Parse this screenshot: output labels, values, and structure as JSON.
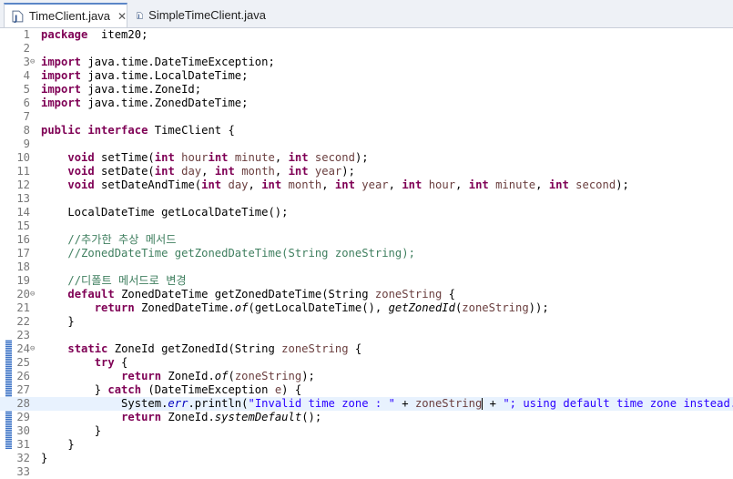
{
  "tabs": [
    {
      "label": "TimeClient.java",
      "active": true,
      "close_icon": "close-icon"
    },
    {
      "label": "SimpleTimeClient.java",
      "active": false
    }
  ],
  "editor": {
    "lines": [
      {
        "n": "1",
        "fold": "",
        "tokens": [
          [
            "kw",
            "package"
          ],
          [
            "",
            "  item20;"
          ]
        ]
      },
      {
        "n": "2",
        "fold": "",
        "tokens": []
      },
      {
        "n": "3",
        "fold": "⊖",
        "tokens": [
          [
            "kw",
            "import"
          ],
          [
            "",
            " java.time.DateTimeException;"
          ]
        ]
      },
      {
        "n": "4",
        "fold": "",
        "tokens": [
          [
            "kw",
            "import"
          ],
          [
            "",
            " java.time.LocalDateTime;"
          ]
        ]
      },
      {
        "n": "5",
        "fold": "",
        "tokens": [
          [
            "kw",
            "import"
          ],
          [
            "",
            " java.time.ZoneId;"
          ]
        ]
      },
      {
        "n": "6",
        "fold": "",
        "tokens": [
          [
            "kw",
            "import"
          ],
          [
            "",
            " java.time.ZonedDateTime;"
          ]
        ]
      },
      {
        "n": "7",
        "fold": "",
        "tokens": []
      },
      {
        "n": "8",
        "fold": "",
        "tokens": [
          [
            "kw",
            "public"
          ],
          [
            "",
            " "
          ],
          [
            "kw",
            "interface"
          ],
          [
            "",
            " TimeClient {"
          ]
        ]
      },
      {
        "n": "9",
        "fold": "",
        "tokens": []
      },
      {
        "n": "10",
        "fold": "",
        "tokens": [
          [
            "",
            "    "
          ],
          [
            "kw",
            "void"
          ],
          [
            "",
            " setTime("
          ],
          [
            "kw",
            "int"
          ],
          [
            "",
            " "
          ],
          [
            "pa",
            "hour"
          ],
          [
            ", "
          ],
          [
            "kw",
            "int"
          ],
          [
            "",
            " "
          ],
          [
            "pa",
            "minute"
          ],
          [
            "",
            ", "
          ],
          [
            "kw",
            "int"
          ],
          [
            "",
            " "
          ],
          [
            "pa",
            "second"
          ],
          [
            "",
            ");"
          ]
        ]
      },
      {
        "n": "11",
        "fold": "",
        "tokens": [
          [
            "",
            "    "
          ],
          [
            "kw",
            "void"
          ],
          [
            "",
            " setDate("
          ],
          [
            "kw",
            "int"
          ],
          [
            "",
            " "
          ],
          [
            "pa",
            "day"
          ],
          [
            "",
            ", "
          ],
          [
            "kw",
            "int"
          ],
          [
            "",
            " "
          ],
          [
            "pa",
            "month"
          ],
          [
            "",
            ", "
          ],
          [
            "kw",
            "int"
          ],
          [
            "",
            " "
          ],
          [
            "pa",
            "year"
          ],
          [
            "",
            ");"
          ]
        ]
      },
      {
        "n": "12",
        "fold": "",
        "tokens": [
          [
            "",
            "    "
          ],
          [
            "kw",
            "void"
          ],
          [
            "",
            " setDateAndTime("
          ],
          [
            "kw",
            "int"
          ],
          [
            "",
            " "
          ],
          [
            "pa",
            "day"
          ],
          [
            "",
            ", "
          ],
          [
            "kw",
            "int"
          ],
          [
            "",
            " "
          ],
          [
            "pa",
            "month"
          ],
          [
            "",
            ", "
          ],
          [
            "kw",
            "int"
          ],
          [
            "",
            " "
          ],
          [
            "pa",
            "year"
          ],
          [
            "",
            ", "
          ],
          [
            "kw",
            "int"
          ],
          [
            "",
            " "
          ],
          [
            "pa",
            "hour"
          ],
          [
            "",
            ", "
          ],
          [
            "kw",
            "int"
          ],
          [
            "",
            " "
          ],
          [
            "pa",
            "minute"
          ],
          [
            "",
            ", "
          ],
          [
            "kw",
            "int"
          ],
          [
            "",
            " "
          ],
          [
            "pa",
            "second"
          ],
          [
            "",
            ");"
          ]
        ]
      },
      {
        "n": "13",
        "fold": "",
        "tokens": []
      },
      {
        "n": "14",
        "fold": "",
        "tokens": [
          [
            "",
            "    LocalDateTime getLocalDateTime();"
          ]
        ]
      },
      {
        "n": "15",
        "fold": "",
        "tokens": []
      },
      {
        "n": "16",
        "fold": "",
        "tokens": [
          [
            "",
            "    "
          ],
          [
            "cm",
            "//추가한 추상 메서드"
          ]
        ]
      },
      {
        "n": "17",
        "fold": "",
        "tokens": [
          [
            "",
            "    "
          ],
          [
            "cm",
            "//ZonedDateTime getZonedDateTime(String zoneString);"
          ]
        ]
      },
      {
        "n": "18",
        "fold": "",
        "tokens": []
      },
      {
        "n": "19",
        "fold": "",
        "tokens": [
          [
            "",
            "    "
          ],
          [
            "cm",
            "//디폴트 메서드로 변경"
          ]
        ]
      },
      {
        "n": "20",
        "fold": "⊖",
        "tokens": [
          [
            "",
            "    "
          ],
          [
            "kw",
            "default"
          ],
          [
            "",
            " ZonedDateTime getZonedDateTime(String "
          ],
          [
            "pa",
            "zoneString"
          ],
          [
            "",
            " {"
          ]
        ]
      },
      {
        "n": "21",
        "fold": "",
        "tokens": [
          [
            "",
            "        "
          ],
          [
            "kw",
            "return"
          ],
          [
            "",
            " ZonedDateTime."
          ],
          [
            "it",
            "of"
          ],
          [
            "",
            "(getLocalDateTime(), "
          ],
          [
            "it",
            "getZonedId"
          ],
          [
            "",
            "("
          ],
          [
            "pa",
            "zoneString"
          ],
          [
            "",
            "));"
          ]
        ]
      },
      {
        "n": "22",
        "fold": "",
        "tokens": [
          [
            "",
            "    }"
          ]
        ]
      },
      {
        "n": "23",
        "fold": "",
        "tokens": []
      },
      {
        "n": "24",
        "fold": "⊖",
        "tokens": [
          [
            "",
            "    "
          ],
          [
            "kw",
            "static"
          ],
          [
            "",
            " ZoneId getZonedId(String "
          ],
          [
            "pa",
            "zoneString"
          ],
          [
            "",
            " {"
          ]
        ]
      },
      {
        "n": "25",
        "fold": "",
        "tokens": [
          [
            "",
            "        "
          ],
          [
            "kw",
            "try"
          ],
          [
            "",
            " {"
          ]
        ]
      },
      {
        "n": "26",
        "fold": "",
        "tokens": [
          [
            "",
            "            "
          ],
          [
            "kw",
            "return"
          ],
          [
            "",
            " ZoneId."
          ],
          [
            "it",
            "of"
          ],
          [
            "",
            "("
          ],
          [
            "pa",
            "zoneString"
          ],
          [
            "",
            ");"
          ]
        ]
      },
      {
        "n": "27",
        "fold": "",
        "tokens": [
          [
            "",
            "        } "
          ],
          [
            "kw",
            "catch"
          ],
          [
            "",
            " (DateTimeException "
          ],
          [
            "pa",
            "e"
          ],
          [
            "",
            ") {"
          ]
        ]
      },
      {
        "n": "28",
        "fold": "",
        "tokens": [
          [
            "",
            "            System."
          ],
          [
            "fi",
            "err"
          ],
          [
            "",
            ".println("
          ],
          [
            "st",
            "\"Invalid time zone : \""
          ],
          [
            "",
            " + "
          ],
          [
            "pa",
            "zoneString"
          ],
          [
            "caret",
            ""
          ],
          [
            "",
            " + "
          ],
          [
            "st",
            "\"; using default time zone instead.\""
          ],
          [
            "",
            ");"
          ]
        ]
      },
      {
        "n": "29",
        "fold": "",
        "tokens": [
          [
            "",
            "            "
          ],
          [
            "kw",
            "return"
          ],
          [
            "",
            " ZoneId."
          ],
          [
            "it",
            "systemDefault"
          ],
          [
            "",
            "();"
          ]
        ]
      },
      {
        "n": "30",
        "fold": "",
        "tokens": [
          [
            "",
            "        }"
          ]
        ]
      },
      {
        "n": "31",
        "fold": "",
        "tokens": [
          [
            "",
            "    }"
          ]
        ]
      },
      {
        "n": "32",
        "fold": "",
        "tokens": [
          [
            "",
            "}"
          ]
        ]
      },
      {
        "n": "33",
        "fold": "",
        "tokens": []
      }
    ]
  },
  "colors": {
    "keyword": "#7f0055",
    "comment": "#3f7f5f",
    "string": "#2a00ff",
    "field": "#0000c0",
    "param": "#6a3e3e",
    "current_line": "#e8f2fe",
    "change_marker": "#3d72c4"
  }
}
